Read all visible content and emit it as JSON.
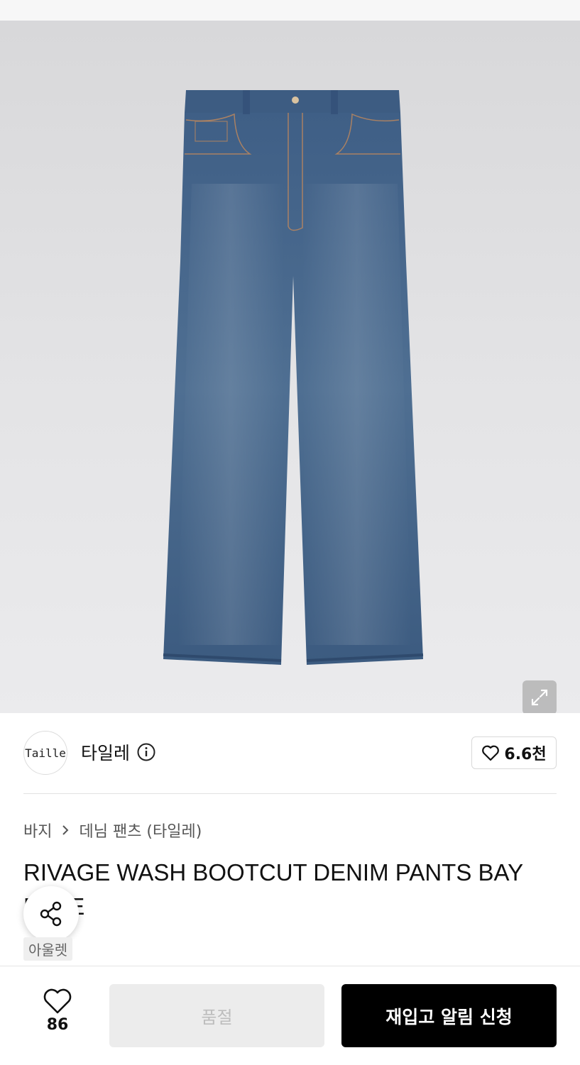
{
  "product_image": {
    "description_icon": "jeans-image"
  },
  "expand": {
    "icon": "expand-arrows-icon"
  },
  "brand": {
    "logo_text": "Taille",
    "name": "타일레",
    "info_icon": "info-icon",
    "likes_label": "6.6천",
    "heart_icon": "heart-outline-icon"
  },
  "breadcrumb": {
    "category": "바지",
    "separator_icon": "chevron-right-icon",
    "subcategory": "데님 팬츠 (타일레)"
  },
  "product": {
    "title": "RIVAGE WASH BOOTCUT DENIM PANTS BAY BLUE",
    "badge": "아울렛"
  },
  "share": {
    "icon": "share-icon"
  },
  "bottom_bar": {
    "wish_count": "86",
    "soldout_label": "품절",
    "restock_label": "재입고 알림 신청"
  }
}
